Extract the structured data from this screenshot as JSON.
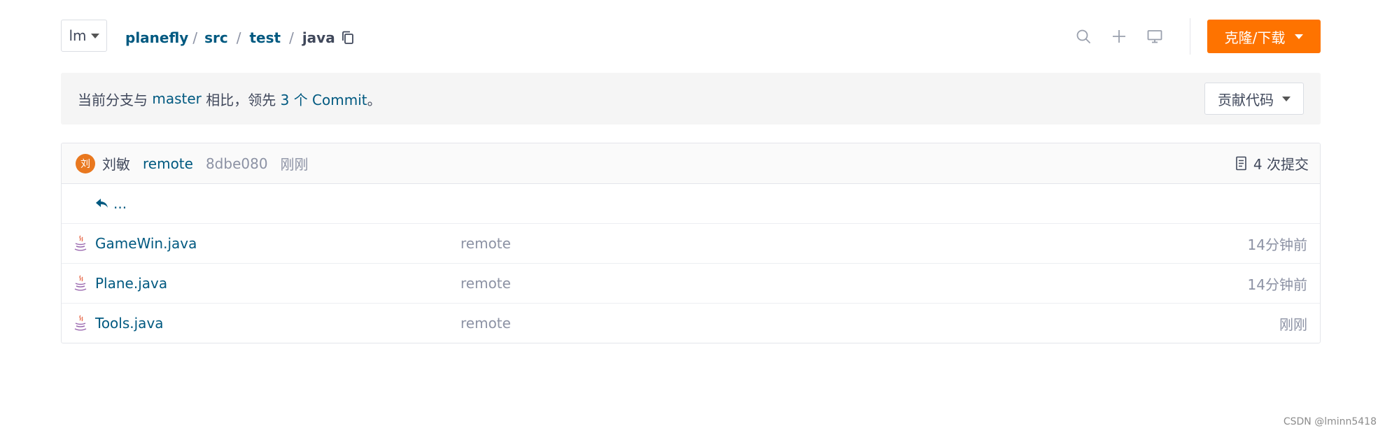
{
  "branch": {
    "label": "lm"
  },
  "breadcrumb": {
    "items": [
      "planefly",
      "src",
      "test"
    ],
    "current": "java",
    "separator": "/"
  },
  "header_tools": [
    "search-icon",
    "plus-icon",
    "monitor-icon"
  ],
  "clone_button": {
    "label": "克隆/下载"
  },
  "compare_notice": {
    "prefix": "当前分支与",
    "branch": "master",
    "middle": "相比，领先",
    "count_text": "3 个 Commit",
    "suffix": "。"
  },
  "contribute_button": {
    "label": "贡献代码"
  },
  "latest_commit": {
    "avatar_char": "刘",
    "author": "刘敏",
    "message": "remote",
    "sha": "8dbe080",
    "time": "刚刚",
    "commit_count_label": "4 次提交"
  },
  "parent_dir": {
    "label": "..."
  },
  "files": [
    {
      "name": "GameWin.java",
      "message": "remote",
      "time": "14分钟前"
    },
    {
      "name": "Plane.java",
      "message": "remote",
      "time": "14分钟前"
    },
    {
      "name": "Tools.java",
      "message": "remote",
      "time": "刚刚"
    }
  ],
  "watermark": "CSDN @lminn5418",
  "colors": {
    "link": "#005980",
    "accent": "#fe7300",
    "avatar": "#e9781f"
  }
}
